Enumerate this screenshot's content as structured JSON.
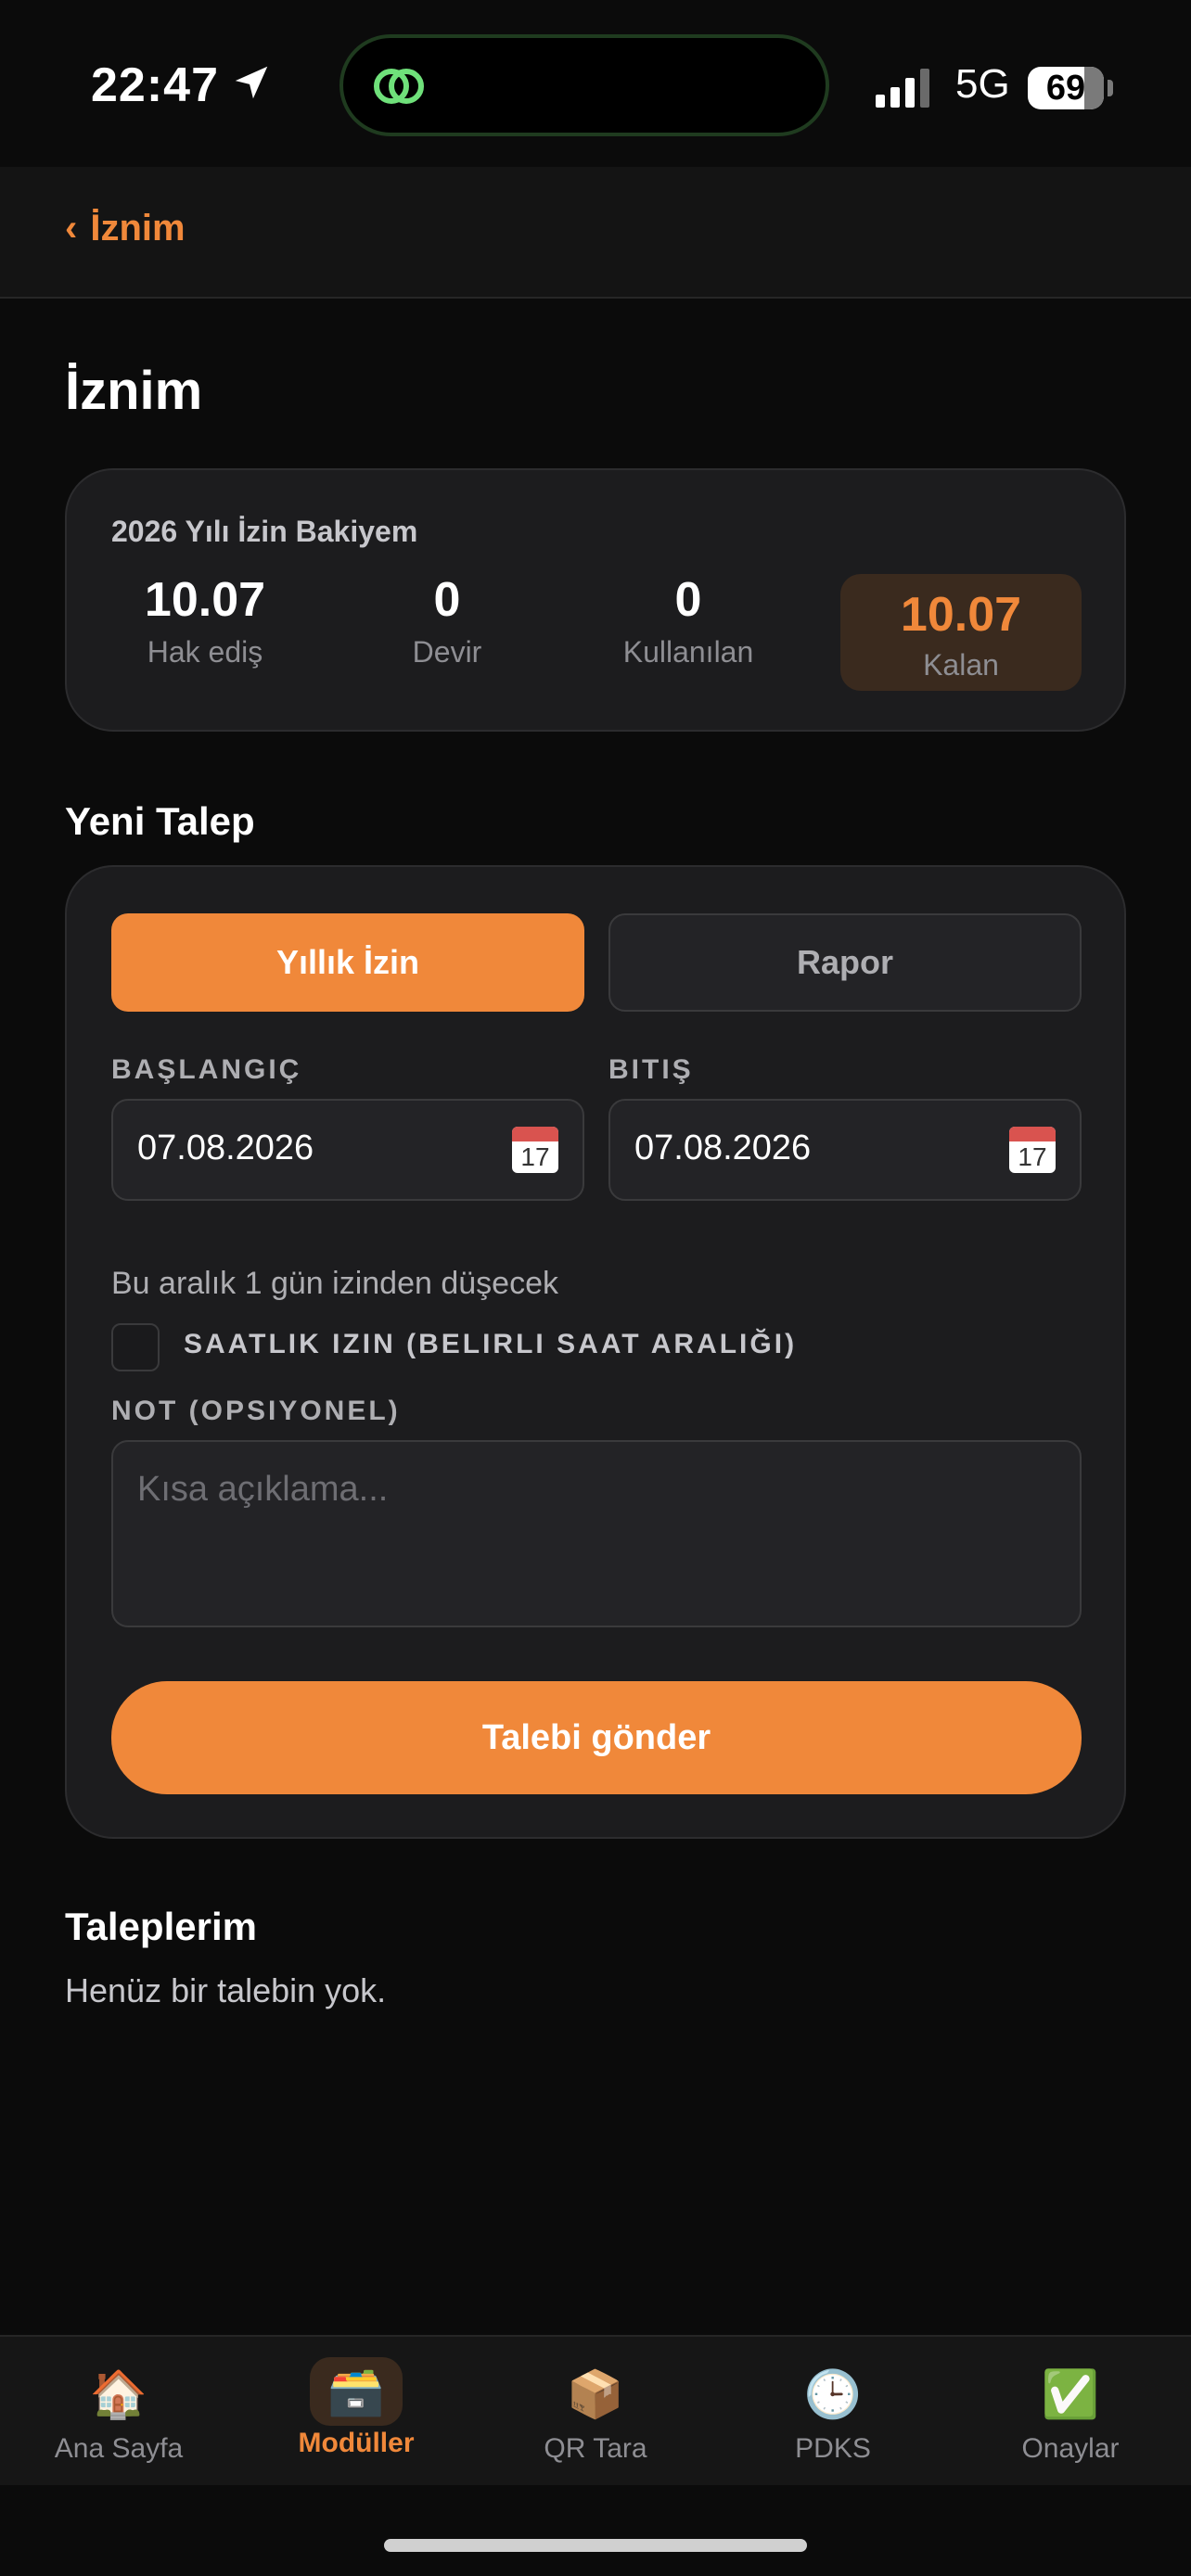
{
  "status_bar": {
    "time": "22:47",
    "network": "5G",
    "battery": "69"
  },
  "nav": {
    "back_label": "İznim",
    "back_chevron": "‹"
  },
  "page": {
    "title": "İznim"
  },
  "balance": {
    "title": "2026 Yılı İzin Bakiyem",
    "earned_value": "10.07",
    "earned_label": "Hak ediş",
    "carry_value": "0",
    "carry_label": "Devir",
    "used_value": "0",
    "used_label": "Kullanılan",
    "remaining_value": "10.07",
    "remaining_label": "Kalan"
  },
  "new_request": {
    "section_title": "Yeni Talep",
    "type_annual": "Yıllık İzin",
    "type_report": "Rapor",
    "start_label": "BAŞLANGIÇ",
    "start_value": "07.08.2026",
    "end_label": "BITIŞ",
    "end_value": "07.08.2026",
    "calendar_day": "17",
    "range_note": "Bu aralık 1 gün izinden düşecek",
    "hourly_label": "SAATLIK IZIN (BELIRLI SAAT ARALIĞI)",
    "note_label": "NOT (OPSIYONEL)",
    "note_placeholder": "Kısa açıklama...",
    "submit_label": "Talebi gönder"
  },
  "my_requests": {
    "title": "Taleplerim",
    "empty_text": "Henüz bir talebin yok."
  },
  "tabs": [
    {
      "label": "Ana Sayfa",
      "icon": "🏠"
    },
    {
      "label": "Modüller",
      "icon": "🗃️"
    },
    {
      "label": "QR Tara",
      "icon": "📦"
    },
    {
      "label": "PDKS",
      "icon": "🕒"
    },
    {
      "label": "Onaylar",
      "icon": "✅"
    }
  ],
  "colors": {
    "accent": "#f0883a",
    "background": "#0b0b0b",
    "card": "#1c1c1e"
  }
}
